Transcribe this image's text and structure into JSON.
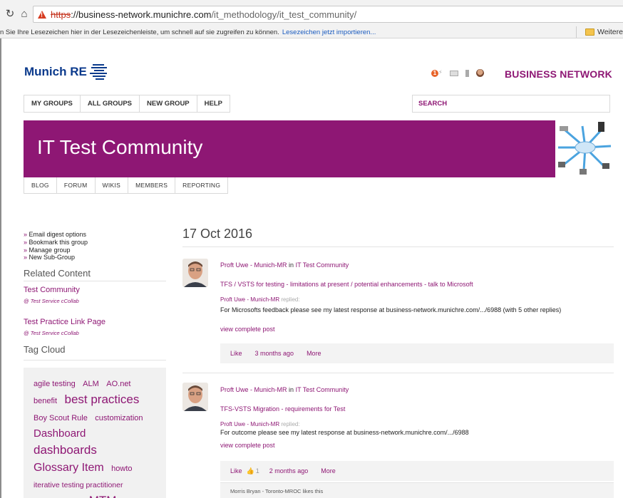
{
  "browser": {
    "url_scheme": "https",
    "url_host": "://business-network.munichre.com",
    "url_path": "/it_methodology/it_test_community/",
    "bookmarks_hint": "n Sie Ihre Lesezeichen hier in der Lesezeichenleiste, um schnell auf sie zugreifen zu können.",
    "bookmarks_import": "Lesezeichen jetzt importieren...",
    "other_bookmarks": "Weitere"
  },
  "header": {
    "logo_text": "Munich RE",
    "notification_count": "1",
    "brand": "BUSINESS NETWORK"
  },
  "main_nav": {
    "items": [
      "MY GROUPS",
      "ALL GROUPS",
      "NEW GROUP",
      "HELP"
    ],
    "search_label": "SEARCH"
  },
  "banner": {
    "title": "IT Test Community"
  },
  "sub_nav": {
    "items": [
      "BLOG",
      "FORUM",
      "WIKIS",
      "MEMBERS",
      "REPORTING"
    ]
  },
  "sidebar": {
    "links": [
      "Email digest options",
      "Bookmark this group",
      "Manage group",
      "New Sub-Group"
    ],
    "related_heading": "Related Content",
    "related": [
      {
        "title": "Test Community",
        "source": "@ Test Service cCollab"
      },
      {
        "title": "Test Practice Link Page",
        "source": "@ Test Service cCollab"
      }
    ],
    "tag_heading": "Tag Cloud",
    "tags": [
      {
        "label": "agile testing",
        "size": 11
      },
      {
        "label": "ALM",
        "size": 11
      },
      {
        "label": "AO.net",
        "size": 11
      },
      {
        "label": "benefit",
        "size": 11
      },
      {
        "label": "best practices",
        "size": 17
      },
      {
        "label": "Boy Scout Rule",
        "size": 11
      },
      {
        "label": "customization",
        "size": 11
      },
      {
        "label": "Dashboard",
        "size": 15
      },
      {
        "label": "dashboards",
        "size": 17
      },
      {
        "label": "Glossary Item",
        "size": 16
      },
      {
        "label": "howto",
        "size": 11
      },
      {
        "label": "iterative testing practitioner",
        "size": 10.5
      },
      {
        "label": "Measurement",
        "size": 11
      },
      {
        "label": "MTM",
        "size": 17
      }
    ]
  },
  "feed": {
    "date": "17 Oct 2016",
    "posts": [
      {
        "author": "Proft Uwe - Munich-MR",
        "in_word": "in",
        "community": "IT Test Community",
        "title": "TFS / VSTS for testing - limitations at present / potential enhancements - talk to Microsoft",
        "reply_author": "Proft Uwe - Munich-MR",
        "reply_verb": "replied:",
        "reply_text": "For Microsofts feedback please see my latest response at business-network.munichre.com/.../6988 (with 5 other replies)",
        "view_link": "view complete post",
        "like": "Like",
        "like_count": "",
        "time": "3 months ago",
        "more": "More"
      },
      {
        "author": "Proft Uwe - Munich-MR",
        "in_word": "in",
        "community": "IT Test Community",
        "title": "TFS-VSTS Migration - requirements for Test",
        "reply_author": "Proft Uwe - Munich-MR",
        "reply_verb": "replied:",
        "reply_text": "For outcome please see my latest response at business-network.munichre.com/.../6988",
        "view_link": "view complete post",
        "like": "Like",
        "like_count": "1",
        "time": "2 months ago",
        "more": "More",
        "likes_text": "Morris Bryan - Toronto-MROC likes this"
      }
    ]
  },
  "colors": {
    "brand_purple": "#8e1774",
    "logo_blue": "#0b3a8c",
    "notification_orange": "#e8642a"
  }
}
